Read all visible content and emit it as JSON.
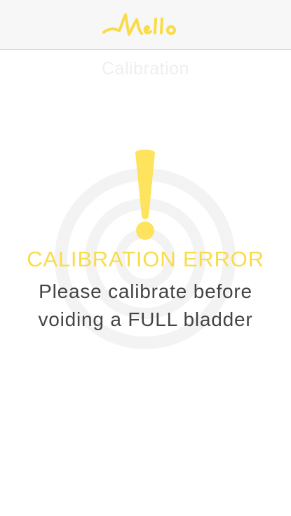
{
  "header": {
    "logo_text": "Mello",
    "logo_icon": "mello-wordmark-logo"
  },
  "page": {
    "title": "Calibration"
  },
  "alert": {
    "icon": "exclamation-icon",
    "title": "CALIBRATION ERROR",
    "message_line1": "Please calibrate before",
    "message_line2": "voiding a FULL bladder"
  },
  "colors": {
    "accent": "#f9dc4a",
    "text": "#444444",
    "header_bg": "#f7f7f7",
    "ring": "#f3f3f3",
    "faded_title": "#efefef"
  }
}
